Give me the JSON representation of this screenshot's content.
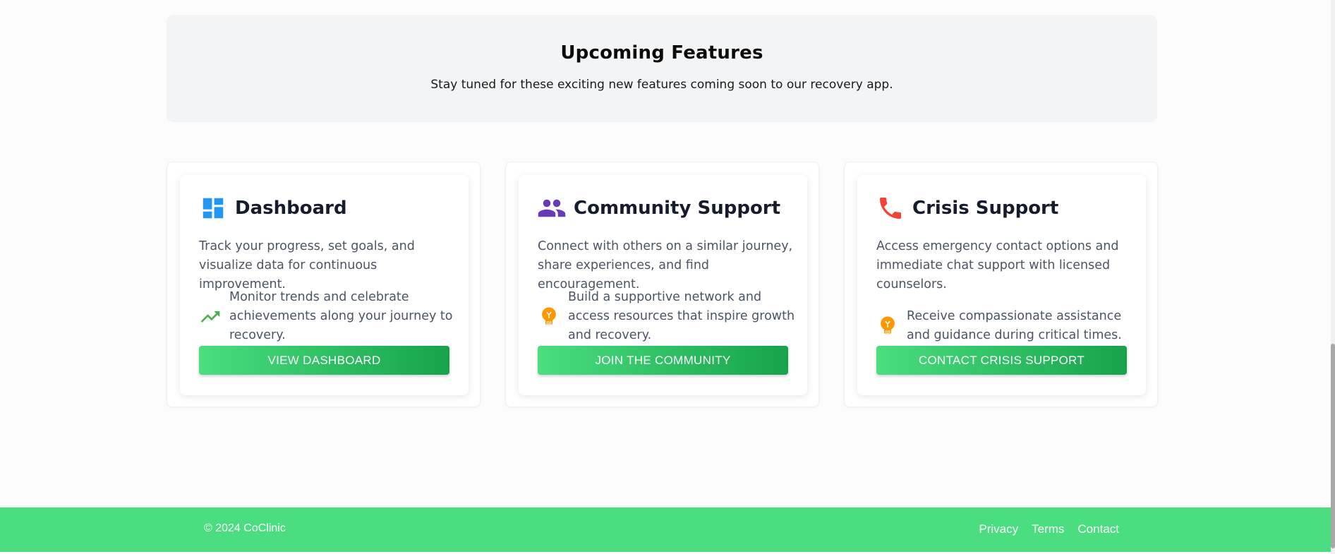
{
  "banner": {
    "title": "Upcoming Features",
    "subtitle": "Stay tuned for these exciting new features coming soon to our recovery app."
  },
  "cards": [
    {
      "icon": "dashboard-icon",
      "title": "Dashboard",
      "description": "Track your progress, set goals, and visualize data for continuous improvement.",
      "feature_icon": "trending-up-icon",
      "feature_text": "Monitor trends and celebrate achievements along your journey to recovery.",
      "button_label": "VIEW DASHBOARD",
      "icon_color": "#2196f3",
      "feature_icon_color": "#4caf50"
    },
    {
      "icon": "people-icon",
      "title": "Community Support",
      "description": "Connect with others on a similar journey, share experiences, and find encouragement.",
      "feature_icon": "lightbulb-icon",
      "feature_text": "Build a supportive network and access resources that inspire growth and recovery.",
      "button_label": "JOIN THE COMMUNITY",
      "icon_color": "#673ab7",
      "feature_icon_color": "#ff9800"
    },
    {
      "icon": "phone-icon",
      "title": "Crisis Support",
      "description": "Access emergency contact options and immediate chat support with licensed counselors.",
      "feature_icon": "lightbulb-icon",
      "feature_text": "Receive compassionate assistance and guidance during critical times.",
      "button_label": "CONTACT CRISIS SUPPORT",
      "icon_color": "#f44336",
      "feature_icon_color": "#ff9800"
    }
  ],
  "footer": {
    "copyright": "© 2024 CoClinic",
    "links": [
      "Privacy",
      "Terms",
      "Contact"
    ],
    "background": "#4ade80"
  },
  "button_gradient": [
    "#4ade80",
    "#16a34a"
  ]
}
